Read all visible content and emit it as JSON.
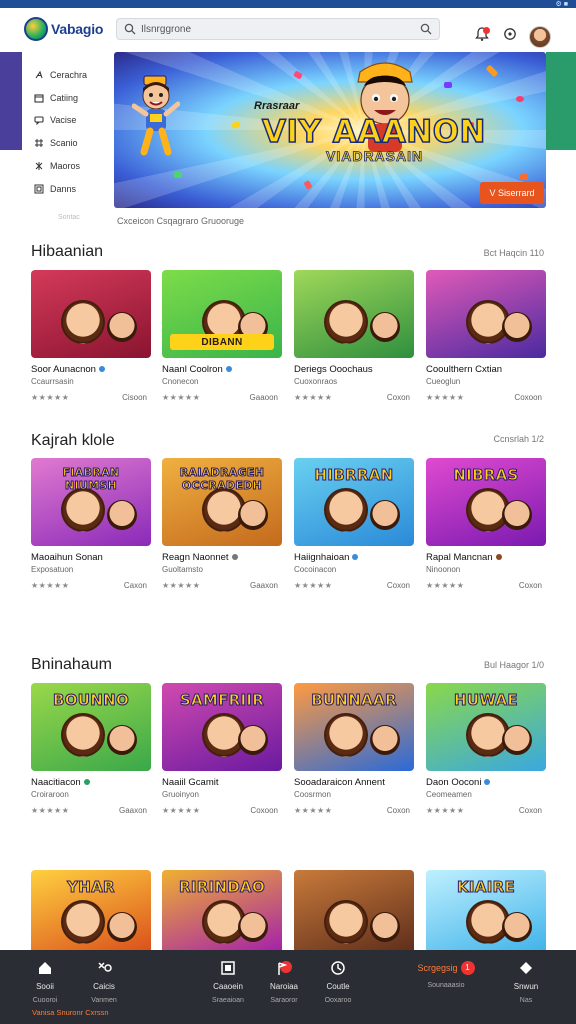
{
  "app": {
    "name": "Vabagio"
  },
  "topbar": {
    "right_text": "⚙ ■"
  },
  "search": {
    "placeholder": "Ilsnrggrone"
  },
  "sidebar": {
    "items": [
      {
        "label": "Cerachra",
        "icon": "arrow-icon"
      },
      {
        "label": "Catiing",
        "icon": "calendar-icon"
      },
      {
        "label": "Vacise",
        "icon": "chat-icon"
      },
      {
        "label": "Scanio",
        "icon": "grid-icon"
      },
      {
        "label": "Maoros",
        "icon": "puzzle-icon"
      },
      {
        "label": "Danns",
        "icon": "controller-icon"
      }
    ],
    "footer": "Sontac"
  },
  "banner": {
    "subtitle": "Rrasraar",
    "title": "VIY AAANON",
    "title2": "VIADRASAIN",
    "cta": "V Siserrard"
  },
  "breadcrumbs": "Cxceicon  Csqagraro   Gruooruge",
  "sections": [
    {
      "title": "Hibaanian",
      "more": "Bct Haqcin 110",
      "cards": [
        {
          "name": "Soor Aunacnon",
          "badge": "#3a8bd8",
          "sub": "Ccaurrsasin",
          "stars": "★★★★★",
          "btn": "Cisoon",
          "thumb_text": "",
          "colors": [
            "#8a1430",
            "#d43a5a"
          ]
        },
        {
          "name": "Naanl Coolron",
          "badge": "#3a8bd8",
          "sub": "Cnonecon",
          "stars": "★★★★★",
          "btn": "Gaaoon",
          "thumb_text": "DIBANN",
          "colors": [
            "#39b44a",
            "#7ddc4a"
          ]
        },
        {
          "name": "Deriegs Ooochaus",
          "badge": "",
          "sub": "Cuoxonraos",
          "stars": "★★★★★",
          "btn": "Coxon",
          "thumb_text": "",
          "colors": [
            "#2f8f3e",
            "#9fd85a"
          ]
        },
        {
          "name": "Cooulthern Cxtian",
          "badge": "",
          "sub": "Cueoglun",
          "stars": "★★★★★",
          "btn": "Coxoon",
          "thumb_text": "",
          "colors": [
            "#4a2aa0",
            "#e05ab8"
          ]
        }
      ]
    },
    {
      "title": "Kajrah klole",
      "more": "Ccnsrlah 1/2",
      "cards": [
        {
          "name": "Maoaihun Sonan",
          "badge": "",
          "sub": "Exposatuon",
          "stars": "★★★★★",
          "btn": "Caxon",
          "thumb_text": "FIABRAN NIUMSH",
          "colors": [
            "#8a2ab8",
            "#e07ad0"
          ]
        },
        {
          "name": "Reagn Naonnet",
          "badge": "#777777",
          "sub": "Guoltamsto",
          "stars": "★★★★★",
          "btn": "Gaaxon",
          "thumb_text": "RAIADRAGEH OCCRADEDH",
          "colors": [
            "#c46a1e",
            "#f0b040"
          ]
        },
        {
          "name": "Haiignhaioan",
          "badge": "#3a8bd8",
          "sub": "Cocoinacon",
          "stars": "★★★★★",
          "btn": "Coxon",
          "thumb_text": "HIBRRAN",
          "colors": [
            "#2a8ad8",
            "#6ad0f0"
          ]
        },
        {
          "name": "Rapal Mancnan",
          "badge": "#8a4a22",
          "sub": "Ninoonon",
          "stars": "★★★★★",
          "btn": "Coxon",
          "thumb_text": "NIBRAS",
          "colors": [
            "#7a1ab0",
            "#e04ad0"
          ]
        }
      ]
    },
    {
      "title": "Bninahaum",
      "more": "Bul Haagor 1/0",
      "cards": [
        {
          "name": "Naacitiacon",
          "badge": "#2aa060",
          "sub": "Croiraroon",
          "stars": "★★★★★",
          "btn": "Gaaxon",
          "thumb_text": "BOUNNO",
          "colors": [
            "#3aa84a",
            "#9ad84a"
          ]
        },
        {
          "name": "Naaiil Gcamit",
          "badge": "",
          "sub": "Gruoinyon",
          "stars": "★★★★★",
          "btn": "Coxoon",
          "thumb_text": "SAMFRIIR",
          "colors": [
            "#6a1aa0",
            "#d04ab0"
          ]
        },
        {
          "name": "Sooadaraicon Annent",
          "badge": "",
          "sub": "Coosrmon",
          "stars": "★★★★★",
          "btn": "Coxon",
          "thumb_text": "BUNNAAR",
          "colors": [
            "#2a6ad8",
            "#ff9a40"
          ]
        },
        {
          "name": "Daon Ooconi",
          "badge": "#3a8bd8",
          "sub": "Ceomeamen",
          "stars": "★★★★★",
          "btn": "Coxon",
          "thumb_text": "HUWAE",
          "colors": [
            "#3aa8e0",
            "#8ad84a"
          ]
        }
      ]
    },
    {
      "title": "",
      "more": "",
      "cards": [
        {
          "name": "",
          "badge": "",
          "sub": "",
          "stars": "",
          "btn": "",
          "thumb_text": "YHAR",
          "colors": [
            "#d84a1a",
            "#ffd040"
          ]
        },
        {
          "name": "",
          "badge": "",
          "sub": "",
          "stars": "",
          "btn": "",
          "thumb_text": "RIRINDAO",
          "colors": [
            "#a01ab0",
            "#f0b030"
          ]
        },
        {
          "name": "",
          "badge": "",
          "sub": "",
          "stars": "",
          "btn": "",
          "thumb_text": "",
          "colors": [
            "#5a2a1a",
            "#c87a3a"
          ]
        },
        {
          "name": "",
          "badge": "",
          "sub": "",
          "stars": "",
          "btn": "",
          "thumb_text": "KIAIRE",
          "colors": [
            "#3ab0e8",
            "#bff0ff"
          ]
        }
      ]
    }
  ],
  "bottom_nav": {
    "tabs": [
      {
        "label": "Sooii",
        "sub": "Cuooroi",
        "icon": "home-icon"
      },
      {
        "label": "Caicis",
        "sub": "Vanmen",
        "icon": "tools-icon"
      },
      {
        "label": "Caaoein",
        "sub": "Sraeaioan",
        "icon": "square-icon"
      },
      {
        "label": "Naroiaa",
        "sub": "Saraoror",
        "icon": "flag-icon"
      },
      {
        "label": "Coutle",
        "sub": "Ooxaroo",
        "icon": "clock-icon"
      },
      {
        "label": "Scrgegsig",
        "sub": "Sounaaasio",
        "icon": "play-icon",
        "badge": "1"
      },
      {
        "label": "Snwun",
        "sub": "Nas",
        "icon": "chat-icon"
      }
    ],
    "footer": "Vanisa Snuronr Cxrssn"
  }
}
